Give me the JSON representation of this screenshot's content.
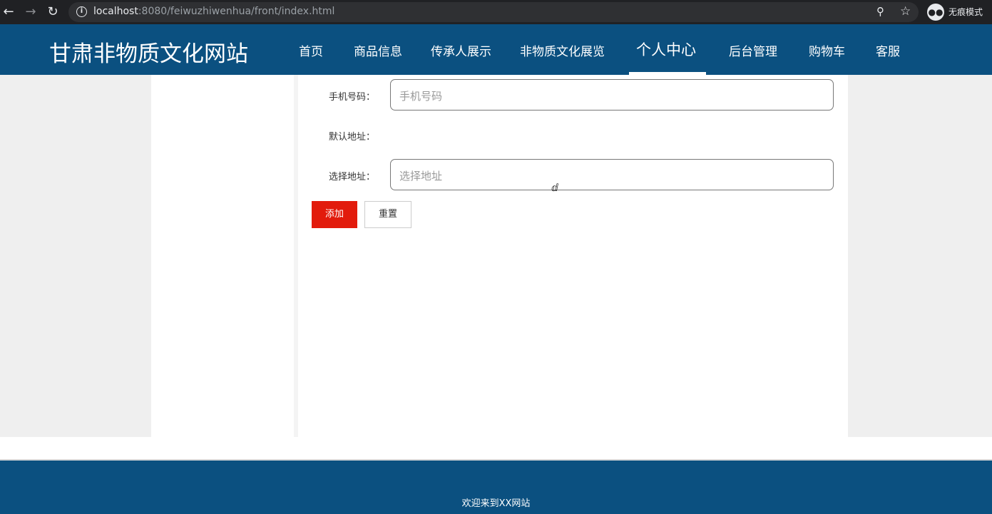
{
  "browser": {
    "url_host": "localhost",
    "url_rest": ":8080/feiwuzhiwenhua/front/index.html",
    "incognito_label": "无痕模式",
    "icons": [
      "back-arrow-icon",
      "forward-arrow-icon",
      "reload-icon",
      "info-icon",
      "key-icon",
      "star-icon",
      "incognito-icon"
    ]
  },
  "header": {
    "site_title": "甘肃非物质文化网站",
    "nav": [
      "首页",
      "商品信息",
      "传承人展示",
      "非物质文化展览",
      "个人中心",
      "后台管理",
      "购物车",
      "客服"
    ],
    "active_nav": "个人中心",
    "background_color": "#0b5080"
  },
  "form": {
    "phone_label": "手机号码：",
    "phone_placeholder": "手机号码",
    "phone_value": "",
    "default_address_label": "默认地址：",
    "select_address_label": "选择地址：",
    "select_address_placeholder": "选择地址",
    "select_address_value": "",
    "add_button": "添加",
    "reset_button": "重置",
    "add_button_color": "#e21b0c"
  },
  "footer": {
    "text": "欢迎来到XX网站"
  }
}
